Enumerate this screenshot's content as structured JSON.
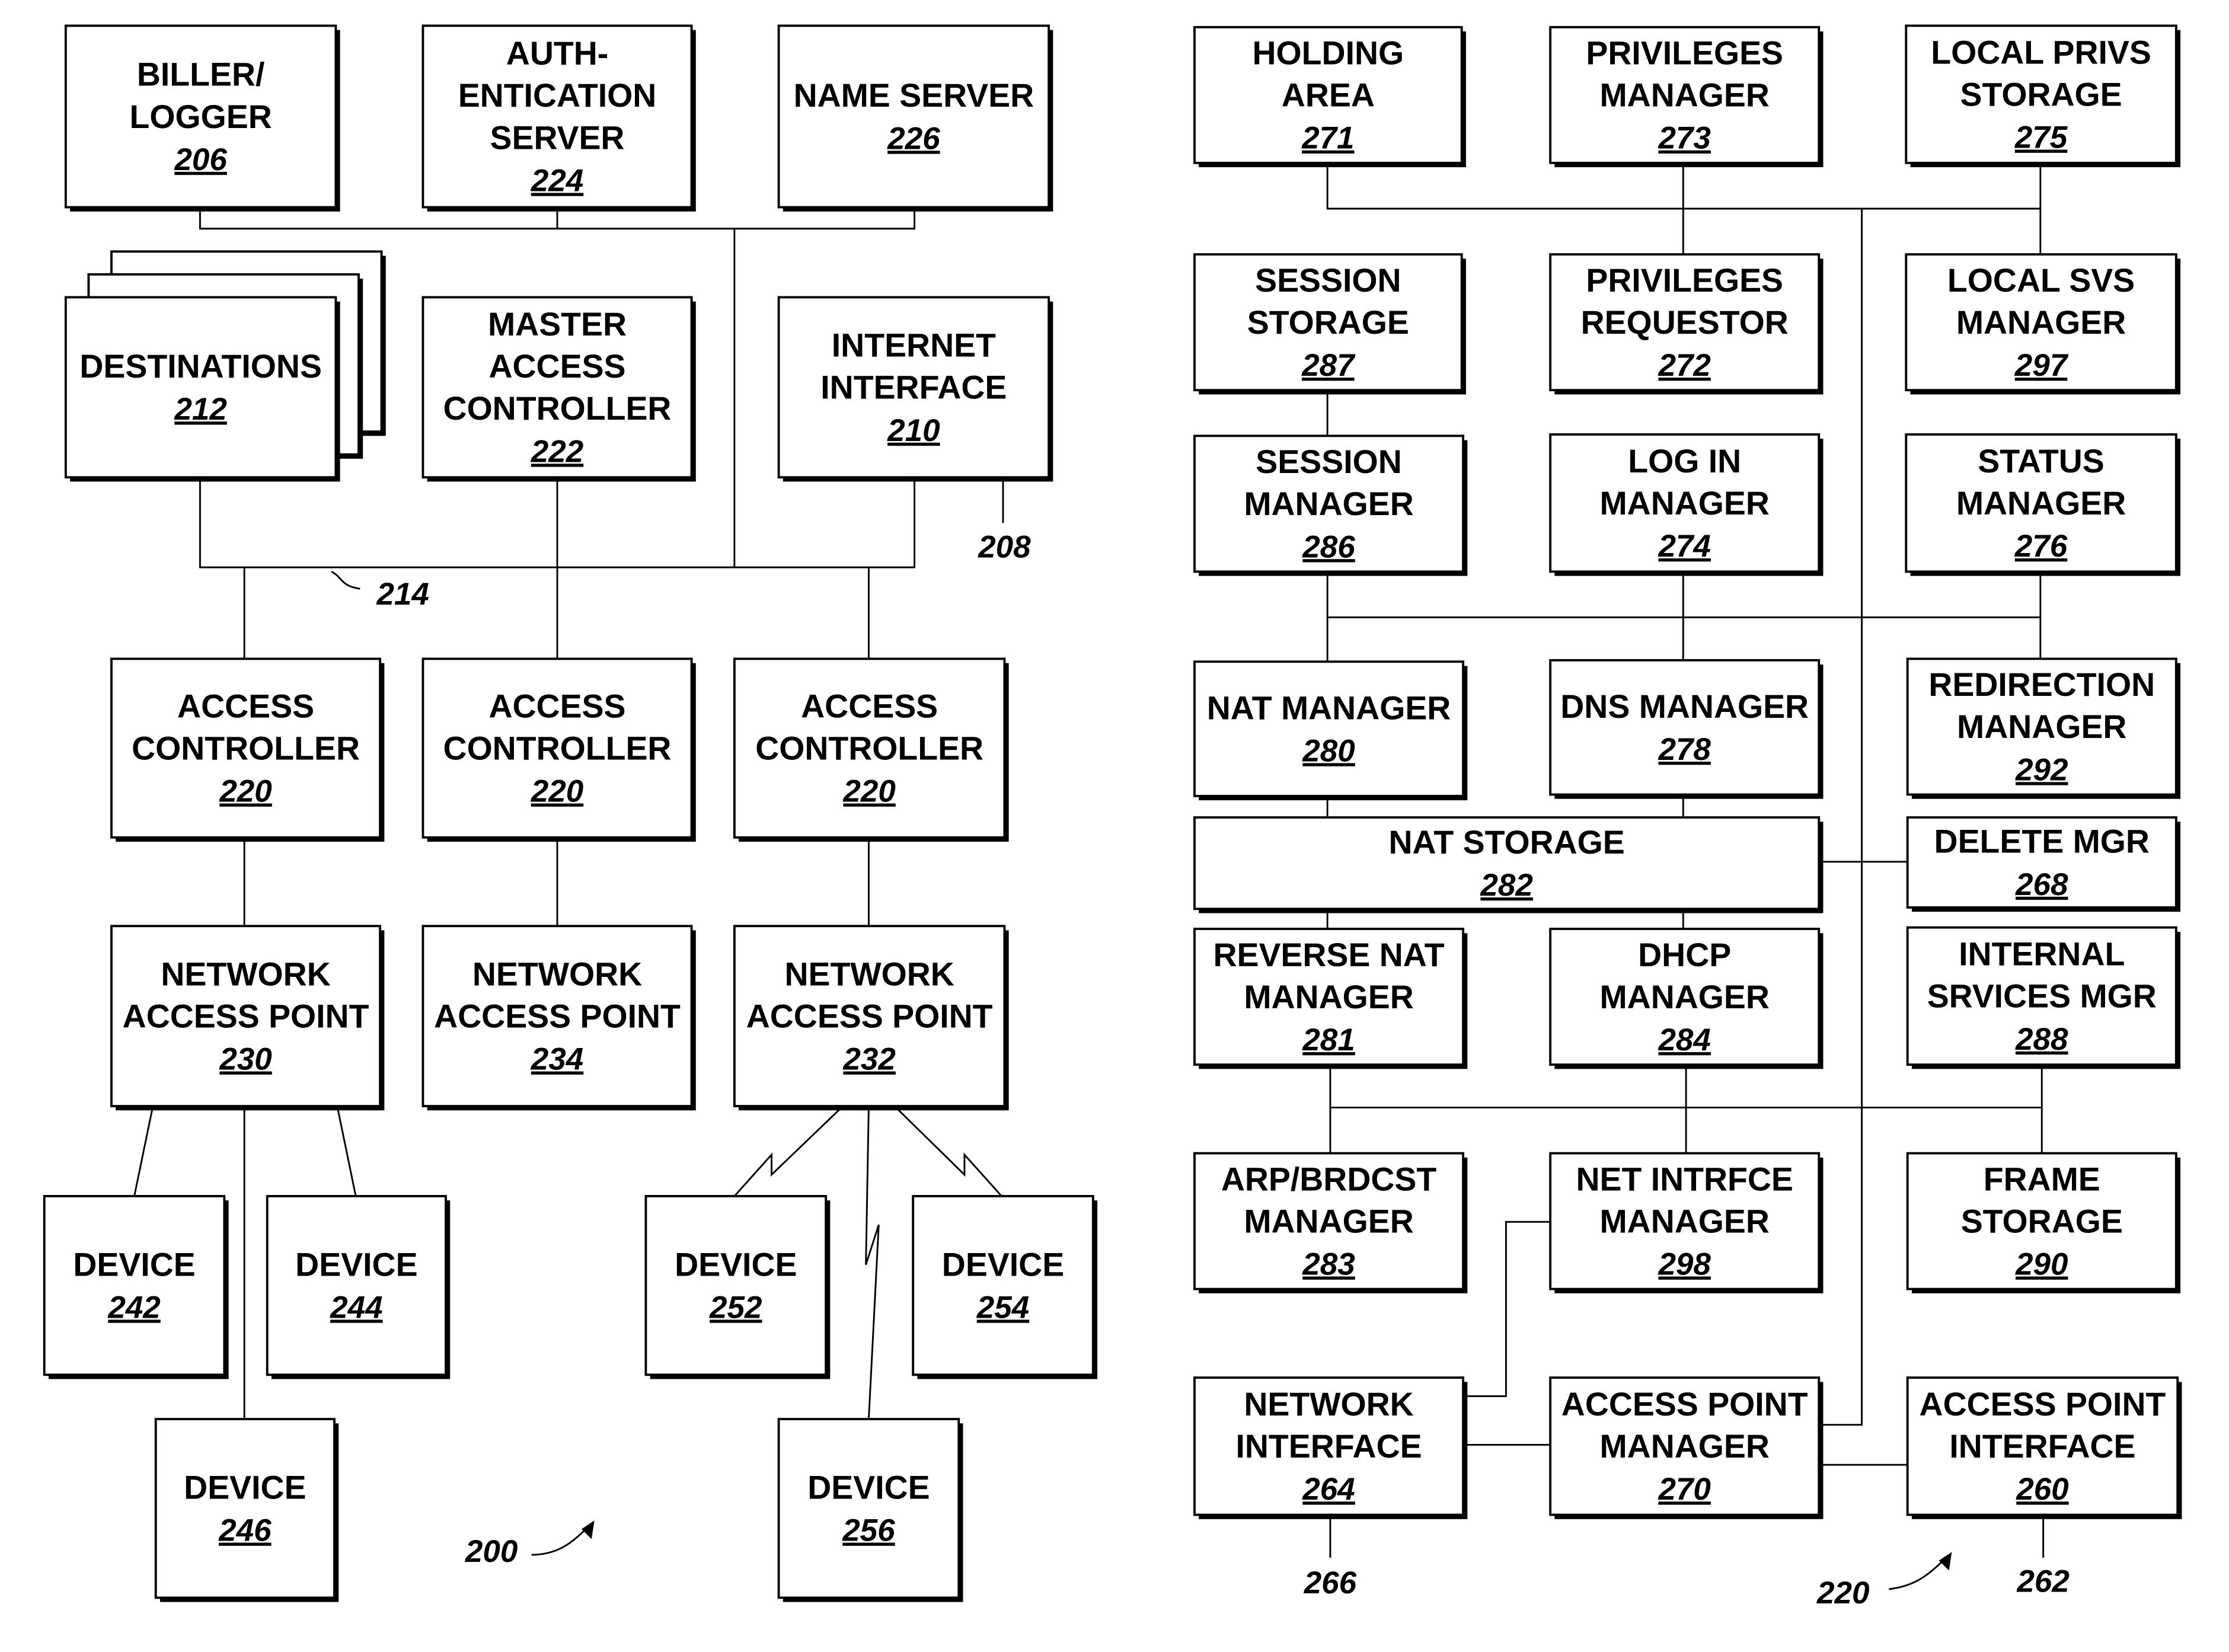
{
  "figure": {
    "left_reference": "200",
    "right_reference": "220"
  },
  "left_diagram": {
    "boxes": [
      {
        "id": "206",
        "lines": [
          "BILLER/",
          "LOGGER"
        ],
        "number": "206"
      },
      {
        "id": "224",
        "lines": [
          "AUTH-",
          "ENTICATION",
          "SERVER"
        ],
        "number": "224"
      },
      {
        "id": "226",
        "lines": [
          "NAME SERVER"
        ],
        "number": "226"
      },
      {
        "id": "212",
        "lines": [
          "DESTINATIONS"
        ],
        "number": "212",
        "stacked": true
      },
      {
        "id": "222",
        "lines": [
          "MASTER",
          "ACCESS",
          "CONTROLLER"
        ],
        "number": "222"
      },
      {
        "id": "210",
        "lines": [
          "INTERNET",
          "INTERFACE"
        ],
        "number": "210"
      },
      {
        "id": "220a",
        "lines": [
          "ACCESS",
          "CONTROLLER"
        ],
        "number": "220"
      },
      {
        "id": "220b",
        "lines": [
          "ACCESS",
          "CONTROLLER"
        ],
        "number": "220"
      },
      {
        "id": "220c",
        "lines": [
          "ACCESS",
          "CONTROLLER"
        ],
        "number": "220"
      },
      {
        "id": "230",
        "lines": [
          "NETWORK",
          "ACCESS POINT"
        ],
        "number": "230"
      },
      {
        "id": "234",
        "lines": [
          "NETWORK",
          "ACCESS POINT"
        ],
        "number": "234"
      },
      {
        "id": "232",
        "lines": [
          "NETWORK",
          "ACCESS POINT"
        ],
        "number": "232"
      },
      {
        "id": "242",
        "lines": [
          "DEVICE"
        ],
        "number": "242"
      },
      {
        "id": "244",
        "lines": [
          "DEVICE"
        ],
        "number": "244"
      },
      {
        "id": "252",
        "lines": [
          "DEVICE"
        ],
        "number": "252"
      },
      {
        "id": "254",
        "lines": [
          "DEVICE"
        ],
        "number": "254"
      },
      {
        "id": "246",
        "lines": [
          "DEVICE"
        ],
        "number": "246"
      },
      {
        "id": "256",
        "lines": [
          "DEVICE"
        ],
        "number": "256"
      }
    ],
    "reference_labels": [
      {
        "id": "ref-208",
        "text": "208"
      },
      {
        "id": "ref-214",
        "text": "214"
      },
      {
        "id": "ref-200",
        "text": "200"
      }
    ]
  },
  "right_diagram": {
    "boxes": [
      {
        "id": "271",
        "lines": [
          "HOLDING",
          "AREA"
        ],
        "number": "271"
      },
      {
        "id": "273",
        "lines": [
          "PRIVILEGES",
          "MANAGER"
        ],
        "number": "273"
      },
      {
        "id": "275",
        "lines": [
          "LOCAL PRIVS",
          "STORAGE"
        ],
        "number": "275"
      },
      {
        "id": "287",
        "lines": [
          "SESSION",
          "STORAGE"
        ],
        "number": "287"
      },
      {
        "id": "272",
        "lines": [
          "PRIVILEGES",
          "REQUESTOR"
        ],
        "number": "272"
      },
      {
        "id": "297",
        "lines": [
          "LOCAL SVS",
          "MANAGER"
        ],
        "number": "297"
      },
      {
        "id": "286",
        "lines": [
          "SESSION",
          "MANAGER"
        ],
        "number": "286"
      },
      {
        "id": "274",
        "lines": [
          "LOG IN",
          "MANAGER"
        ],
        "number": "274"
      },
      {
        "id": "276",
        "lines": [
          "STATUS",
          "MANAGER"
        ],
        "number": "276"
      },
      {
        "id": "280",
        "lines": [
          "NAT MANAGER"
        ],
        "number": "280"
      },
      {
        "id": "278",
        "lines": [
          "DNS MANAGER"
        ],
        "number": "278"
      },
      {
        "id": "292",
        "lines": [
          "REDIRECTION",
          "MANAGER"
        ],
        "number": "292"
      },
      {
        "id": "282",
        "lines": [
          "NAT STORAGE"
        ],
        "number": "282"
      },
      {
        "id": "268",
        "lines": [
          "DELETE MGR"
        ],
        "number": "268"
      },
      {
        "id": "281",
        "lines": [
          "REVERSE NAT",
          "MANAGER"
        ],
        "number": "281"
      },
      {
        "id": "284",
        "lines": [
          "DHCP",
          "MANAGER"
        ],
        "number": "284"
      },
      {
        "id": "288",
        "lines": [
          "INTERNAL",
          "SRVICES MGR"
        ],
        "number": "288"
      },
      {
        "id": "283",
        "lines": [
          "ARP/BRDCST",
          "MANAGER"
        ],
        "number": "283"
      },
      {
        "id": "298",
        "lines": [
          "NET INTRFCE",
          "MANAGER"
        ],
        "number": "298"
      },
      {
        "id": "290",
        "lines": [
          "FRAME",
          "STORAGE"
        ],
        "number": "290"
      },
      {
        "id": "264",
        "lines": [
          "NETWORK",
          "INTERFACE"
        ],
        "number": "264"
      },
      {
        "id": "270",
        "lines": [
          "ACCESS POINT",
          "MANAGER"
        ],
        "number": "270"
      },
      {
        "id": "260",
        "lines": [
          "ACCESS POINT",
          "INTERFACE"
        ],
        "number": "260"
      }
    ],
    "reference_labels": [
      {
        "id": "ref-266",
        "text": "266"
      },
      {
        "id": "ref-262",
        "text": "262"
      },
      {
        "id": "ref-220",
        "text": "220"
      }
    ]
  }
}
